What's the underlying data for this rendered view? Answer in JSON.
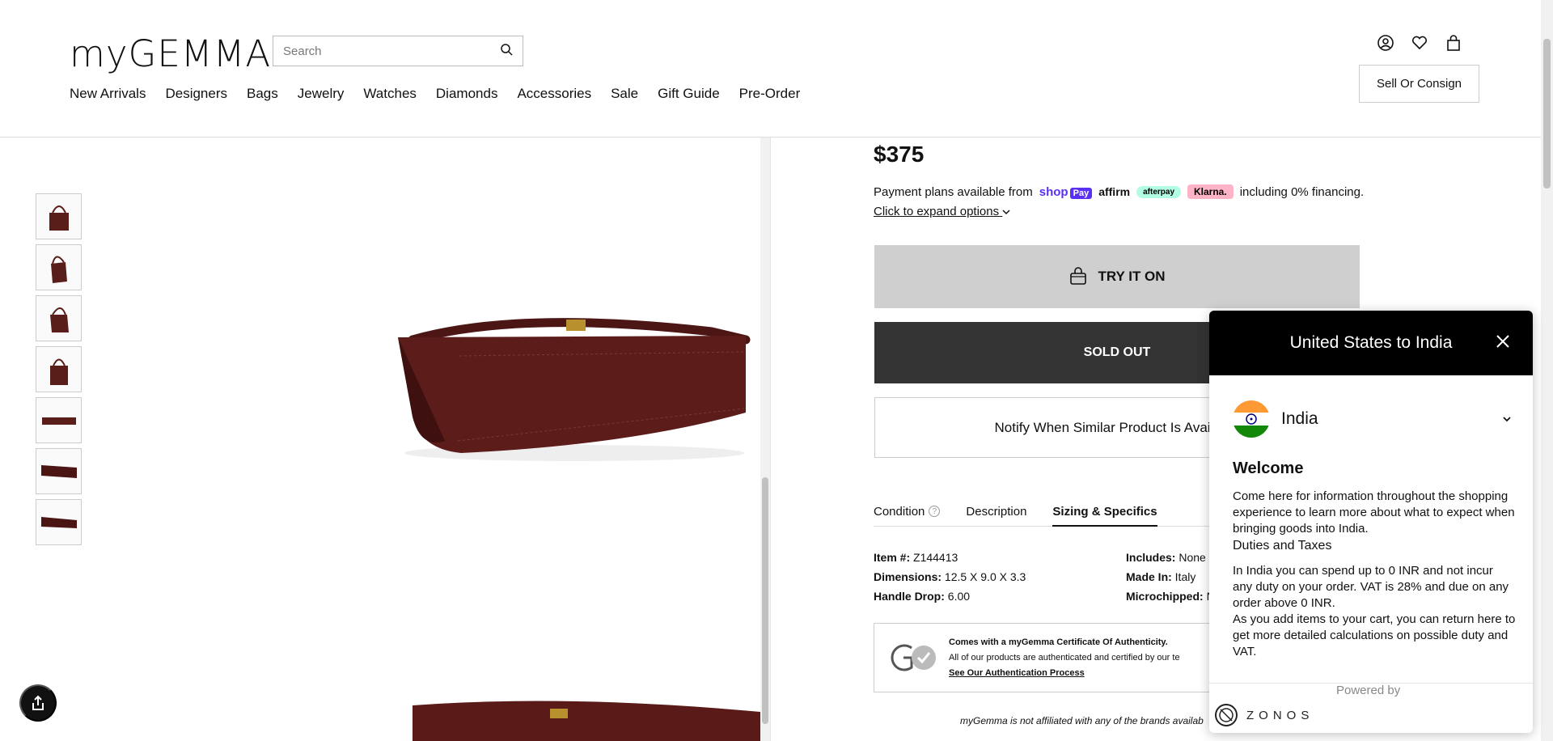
{
  "header": {
    "logo": "myGEMMA",
    "search_placeholder": "Search",
    "nav": [
      "New Arrivals",
      "Designers",
      "Bags",
      "Jewelry",
      "Watches",
      "Diamonds",
      "Accessories",
      "Sale",
      "Gift Guide",
      "Pre-Order"
    ],
    "sell_button": "Sell Or Consign"
  },
  "product": {
    "price": "$375",
    "payment_prefix": "Payment plans available from",
    "payment_suffix": "including 0% financing.",
    "shop_pay": "shop",
    "shop_pay_badge": "Pay",
    "affirm": "affirm",
    "afterpay": "afterpay",
    "klarna": "Klarna.",
    "expand_link": "Click to expand options",
    "try_on": "TRY IT ON",
    "sold_out": "SOLD OUT",
    "notify": "Notify When Similar Product Is Available",
    "tabs": [
      "Condition",
      "Description",
      "Sizing & Specifics"
    ],
    "specs_left": [
      {
        "label": "Item #:",
        "value": "Z144413"
      },
      {
        "label": "Dimensions:",
        "value": "12.5 X 9.0 X 3.3"
      },
      {
        "label": "Handle Drop:",
        "value": "6.00"
      }
    ],
    "specs_right": [
      {
        "label": "Includes:",
        "value": "None"
      },
      {
        "label": "Made In:",
        "value": "Italy"
      },
      {
        "label": "Microchipped:",
        "value": "N"
      }
    ],
    "cert_line1": "Comes with a myGemma Certificate Of Authenticity.",
    "cert_line2": "All of our products are authenticated and certified by our te",
    "cert_link": "See Our Authentication Process",
    "disclaimer": "myGemma is not affiliated with any of the brands availab"
  },
  "modal": {
    "title": "United States to India",
    "country": "India",
    "welcome": "Welcome",
    "welcome_text": "Come here for information throughout the shopping experience to learn more about what to expect when bringing goods into India.",
    "duties_title": "Duties and Taxes",
    "duties_text": "In India you can spend up to 0 INR and not incur any duty on your order. VAT is 28% and due on any order above 0 INR.",
    "duties_text2": "As you add items to your cart, you can return here to get more detailed calculations on possible duty and VAT.",
    "powered_by": "Powered by",
    "zonos": "ZONOS"
  }
}
